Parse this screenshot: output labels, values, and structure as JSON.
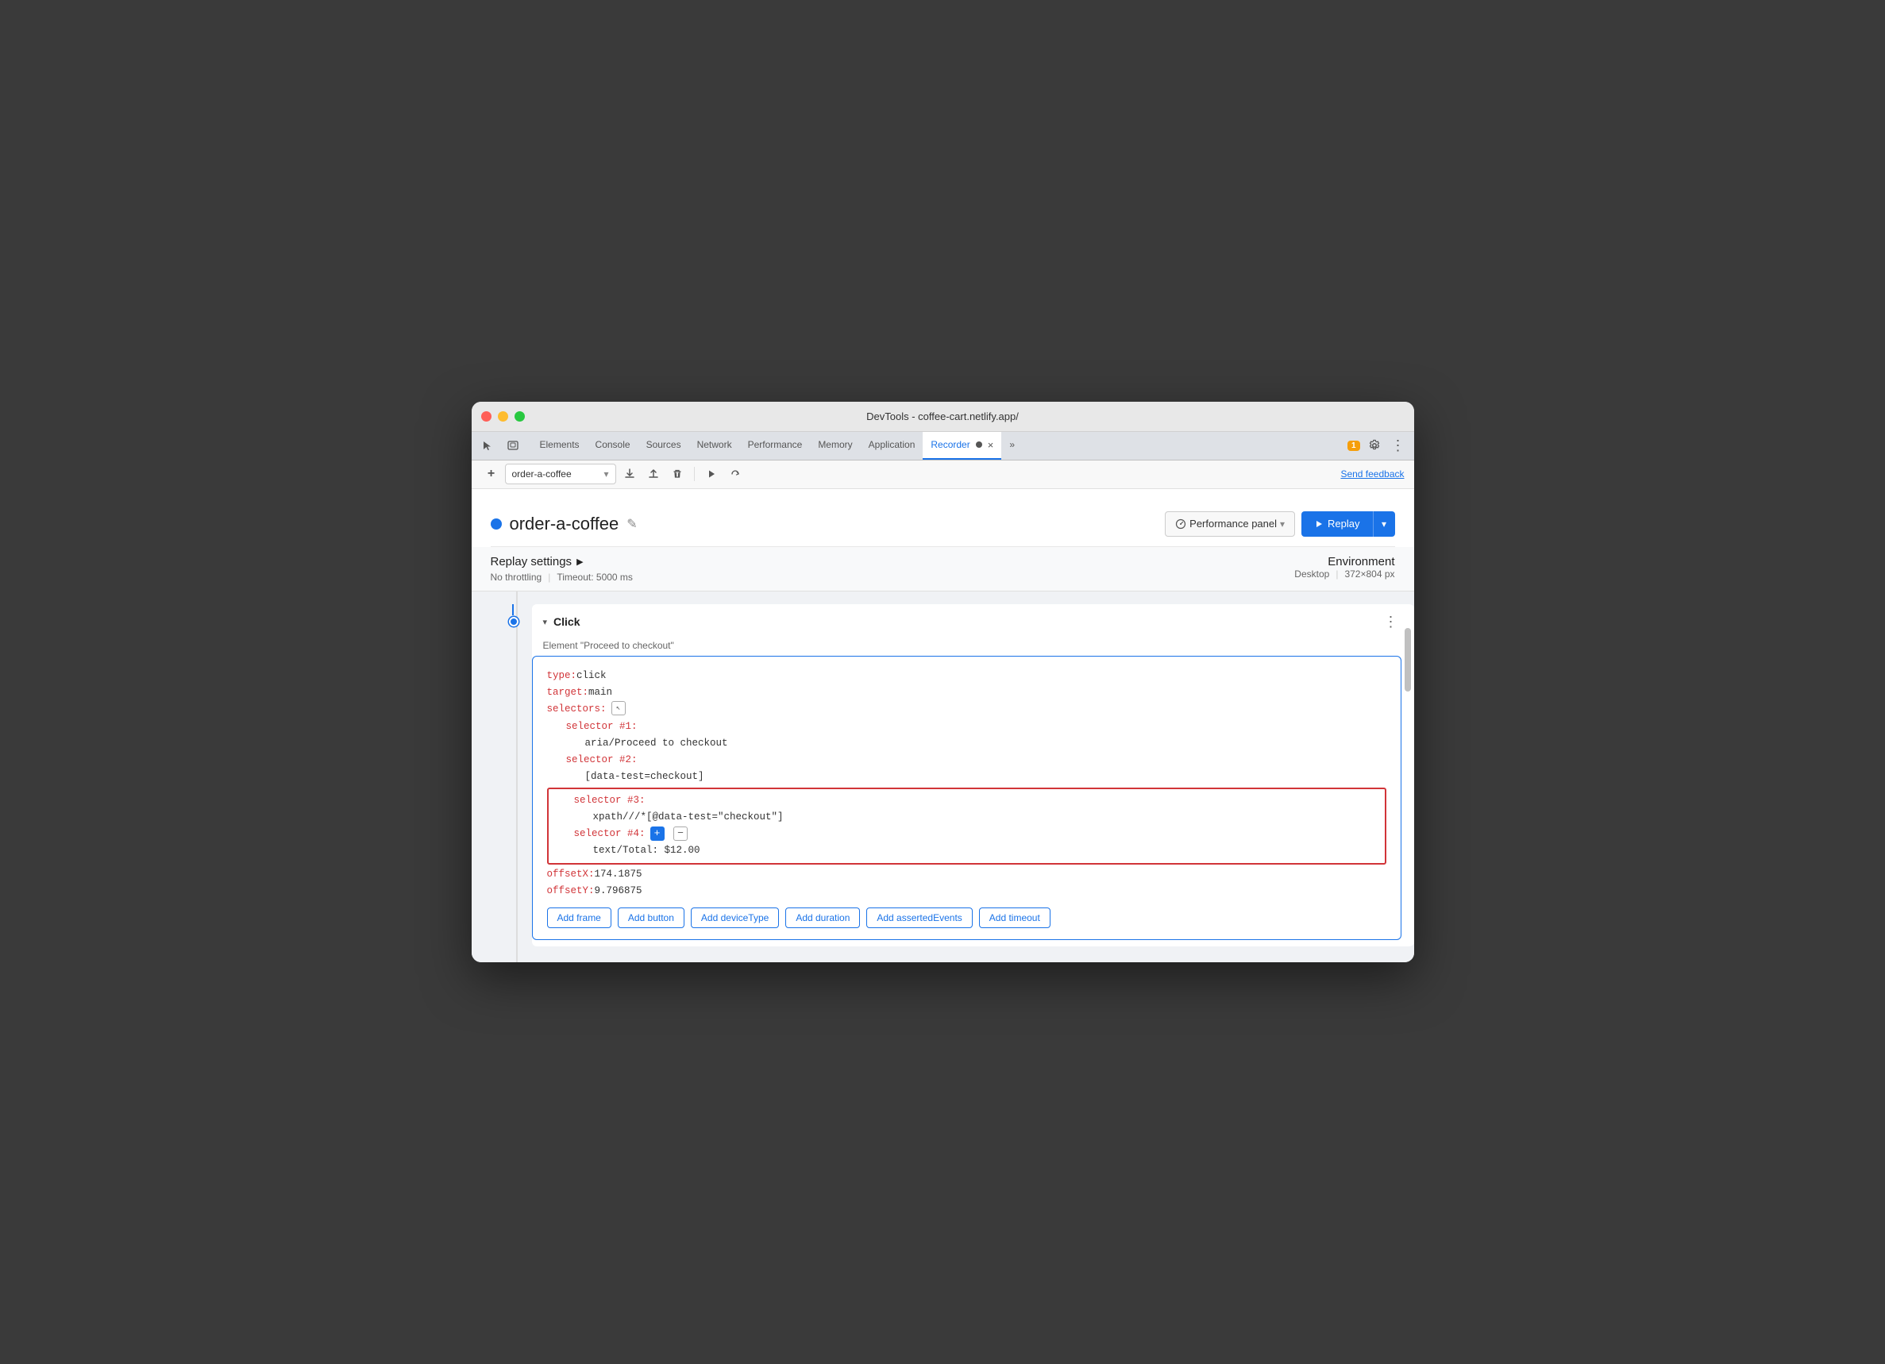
{
  "window": {
    "title": "DevTools - coffee-cart.netlify.app/"
  },
  "tabs": [
    {
      "id": "elements",
      "label": "Elements",
      "active": false
    },
    {
      "id": "console",
      "label": "Console",
      "active": false
    },
    {
      "id": "sources",
      "label": "Sources",
      "active": false
    },
    {
      "id": "network",
      "label": "Network",
      "active": false
    },
    {
      "id": "performance",
      "label": "Performance",
      "active": false
    },
    {
      "id": "memory",
      "label": "Memory",
      "active": false
    },
    {
      "id": "application",
      "label": "Application",
      "active": false
    },
    {
      "id": "recorder",
      "label": "Recorder",
      "active": true
    },
    {
      "id": "more",
      "label": "»",
      "active": false
    }
  ],
  "toolbar": {
    "recording_name": "order-a-coffee",
    "send_feedback": "Send feedback"
  },
  "recording": {
    "title": "order-a-coffee",
    "dot_color": "#1a73e8"
  },
  "buttons": {
    "performance_panel": "Performance panel",
    "replay": "Replay"
  },
  "settings": {
    "title": "Replay settings",
    "throttling": "No throttling",
    "timeout": "Timeout: 5000 ms",
    "environment_title": "Environment",
    "environment_type": "Desktop",
    "environment_size": "372×804 px"
  },
  "step": {
    "type": "Click",
    "element": "Element \"Proceed to checkout\"",
    "code": {
      "type_key": "type:",
      "type_val": " click",
      "target_key": "target:",
      "target_val": " main",
      "selectors_key": "selectors:",
      "selector1_key": "selector #1:",
      "selector1_val": "aria/Proceed to checkout",
      "selector2_key": "selector #2:",
      "selector2_val": "[data-test=checkout]",
      "selector3_key": "selector #3:",
      "selector3_val": "xpath///*[@data-test=\"checkout\"]",
      "selector4_key": "selector #4:",
      "selector4_val": "text/Total: $12.00",
      "offsetX_key": "offsetX:",
      "offsetX_val": " 174.1875",
      "offsetY_key": "offsetY:",
      "offsetY_val": " 9.796875"
    }
  },
  "action_buttons": [
    "Add frame",
    "Add button",
    "Add deviceType",
    "Add duration",
    "Add assertedEvents",
    "Add timeout"
  ],
  "notification_badge": "1",
  "icons": {
    "cursor": "⬛",
    "pointer": "↖",
    "screenshot": "▣",
    "add": "+",
    "upload": "↑",
    "download": "↓",
    "trash": "🗑",
    "play": "▶",
    "refresh": "↺",
    "gear": "⚙",
    "ellipsis": "⋮",
    "more": "⋮⋮",
    "chevron_right": "▶",
    "chevron_down": "▾",
    "edit": "✎",
    "dropdown": "▾",
    "play_small": "▶"
  }
}
